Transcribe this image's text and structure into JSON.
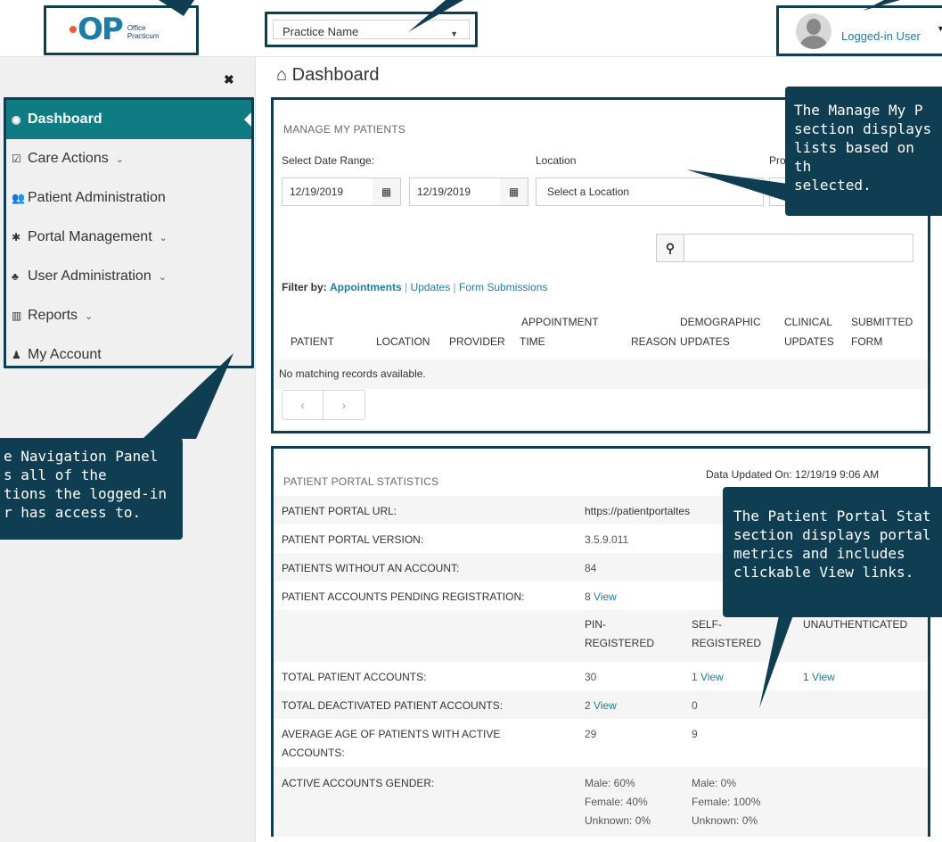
{
  "header": {
    "logo": {
      "mark": "OP",
      "text_line1": "Office",
      "text_line2": "Practicum"
    },
    "practice_select": "Practice Name",
    "user_name": "Logged-in User"
  },
  "sidebar": {
    "items": [
      {
        "label": "Dashboard",
        "icon": "dashboard-icon",
        "active": true
      },
      {
        "label": "Care Actions",
        "icon": "check-square-icon",
        "chevron": "⌄"
      },
      {
        "label": "Patient Administration",
        "icon": "users-icon"
      },
      {
        "label": "Portal Management",
        "icon": "gear-icon",
        "chevron": "⌄"
      },
      {
        "label": "User Administration",
        "icon": "user-admin-icon",
        "chevron": "⌄"
      },
      {
        "label": "Reports",
        "icon": "bar-chart-icon",
        "chevron": "⌄"
      },
      {
        "label": "My Account",
        "icon": "user-icon"
      }
    ]
  },
  "callouts": {
    "nav": [
      "e Navigation Panel",
      "s all of the",
      "tions the logged-in",
      "r has access to."
    ],
    "manage": [
      "The Manage My P",
      "section displays",
      "lists based on th",
      "selected."
    ],
    "portal": [
      "The Patient Portal Stat",
      "section displays portal",
      "metrics and includes",
      "clickable View links."
    ]
  },
  "main": {
    "title": "Dashboard",
    "manage": {
      "title": "MANAGE MY PATIENTS",
      "date_range_label": "Select Date Range:",
      "location_label": "Location",
      "provider_label_partial": "Pro",
      "date_from": "12/19/2019",
      "date_to": "12/19/2019",
      "location_placeholder": "Select a Location",
      "filter_label": "Filter by:",
      "filter_appointments": "Appointments",
      "filter_updates": "Updates",
      "filter_forms": "Form Submissions",
      "sep": "|",
      "columns": {
        "patient": "PATIENT",
        "location": "LOCATION",
        "provider": "PROVIDER",
        "appt_top": "APPOINTMENT",
        "appt_bottom": "TIME",
        "reason": "REASON",
        "demo_top": "DEMOGRAPHIC",
        "demo_bottom": "UPDATES",
        "clinical_top": "CLINICAL",
        "clinical_bottom": "UPDATES",
        "submitted_top": "SUBMITTED",
        "submitted_bottom": "FORM"
      },
      "empty": "No matching records available.",
      "pager_prev": "‹",
      "pager_next": "›"
    },
    "portal": {
      "title": "PATIENT PORTAL STATISTICS",
      "updated": "Data Updated On: 12/19/19 9:06 AM",
      "rows": {
        "url_label": "PATIENT PORTAL URL:",
        "url_value": "https://patientportaltes",
        "version_label": "PATIENT PORTAL VERSION:",
        "version_value": "3.5.9.011",
        "no_account_label": "PATIENTS WITHOUT AN ACCOUNT:",
        "no_account_value": "84",
        "pending_label": "PATIENT ACCOUNTS PENDING REGISTRATION:",
        "pending_value": "8",
        "view": "View",
        "col_pin_top": "PIN-",
        "col_pin_bottom": "REGISTERED",
        "col_self_top": "SELF-",
        "col_self_bottom": "REGISTERED",
        "col_unauth": "UNAUTHENTICATED",
        "total_label": "TOTAL PATIENT ACCOUNTS:",
        "total_pin": "30",
        "total_self": "1",
        "total_unauth": "1",
        "deact_label": "TOTAL DEACTIVATED PATIENT ACCOUNTS:",
        "deact_pin": "2",
        "deact_self": "0",
        "age_label_1": "AVERAGE AGE OF PATIENTS WITH ACTIVE",
        "age_label_2": "ACCOUNTS:",
        "age_pin": "29",
        "age_self": "9",
        "gender_label": "ACTIVE ACCOUNTS GENDER:",
        "gender_pin": [
          "Male: 60%",
          "Female: 40%",
          "Unknown: 0%"
        ],
        "gender_self": [
          "Male: 0%",
          "Female: 100%",
          "Unknown: 0%"
        ]
      }
    }
  }
}
